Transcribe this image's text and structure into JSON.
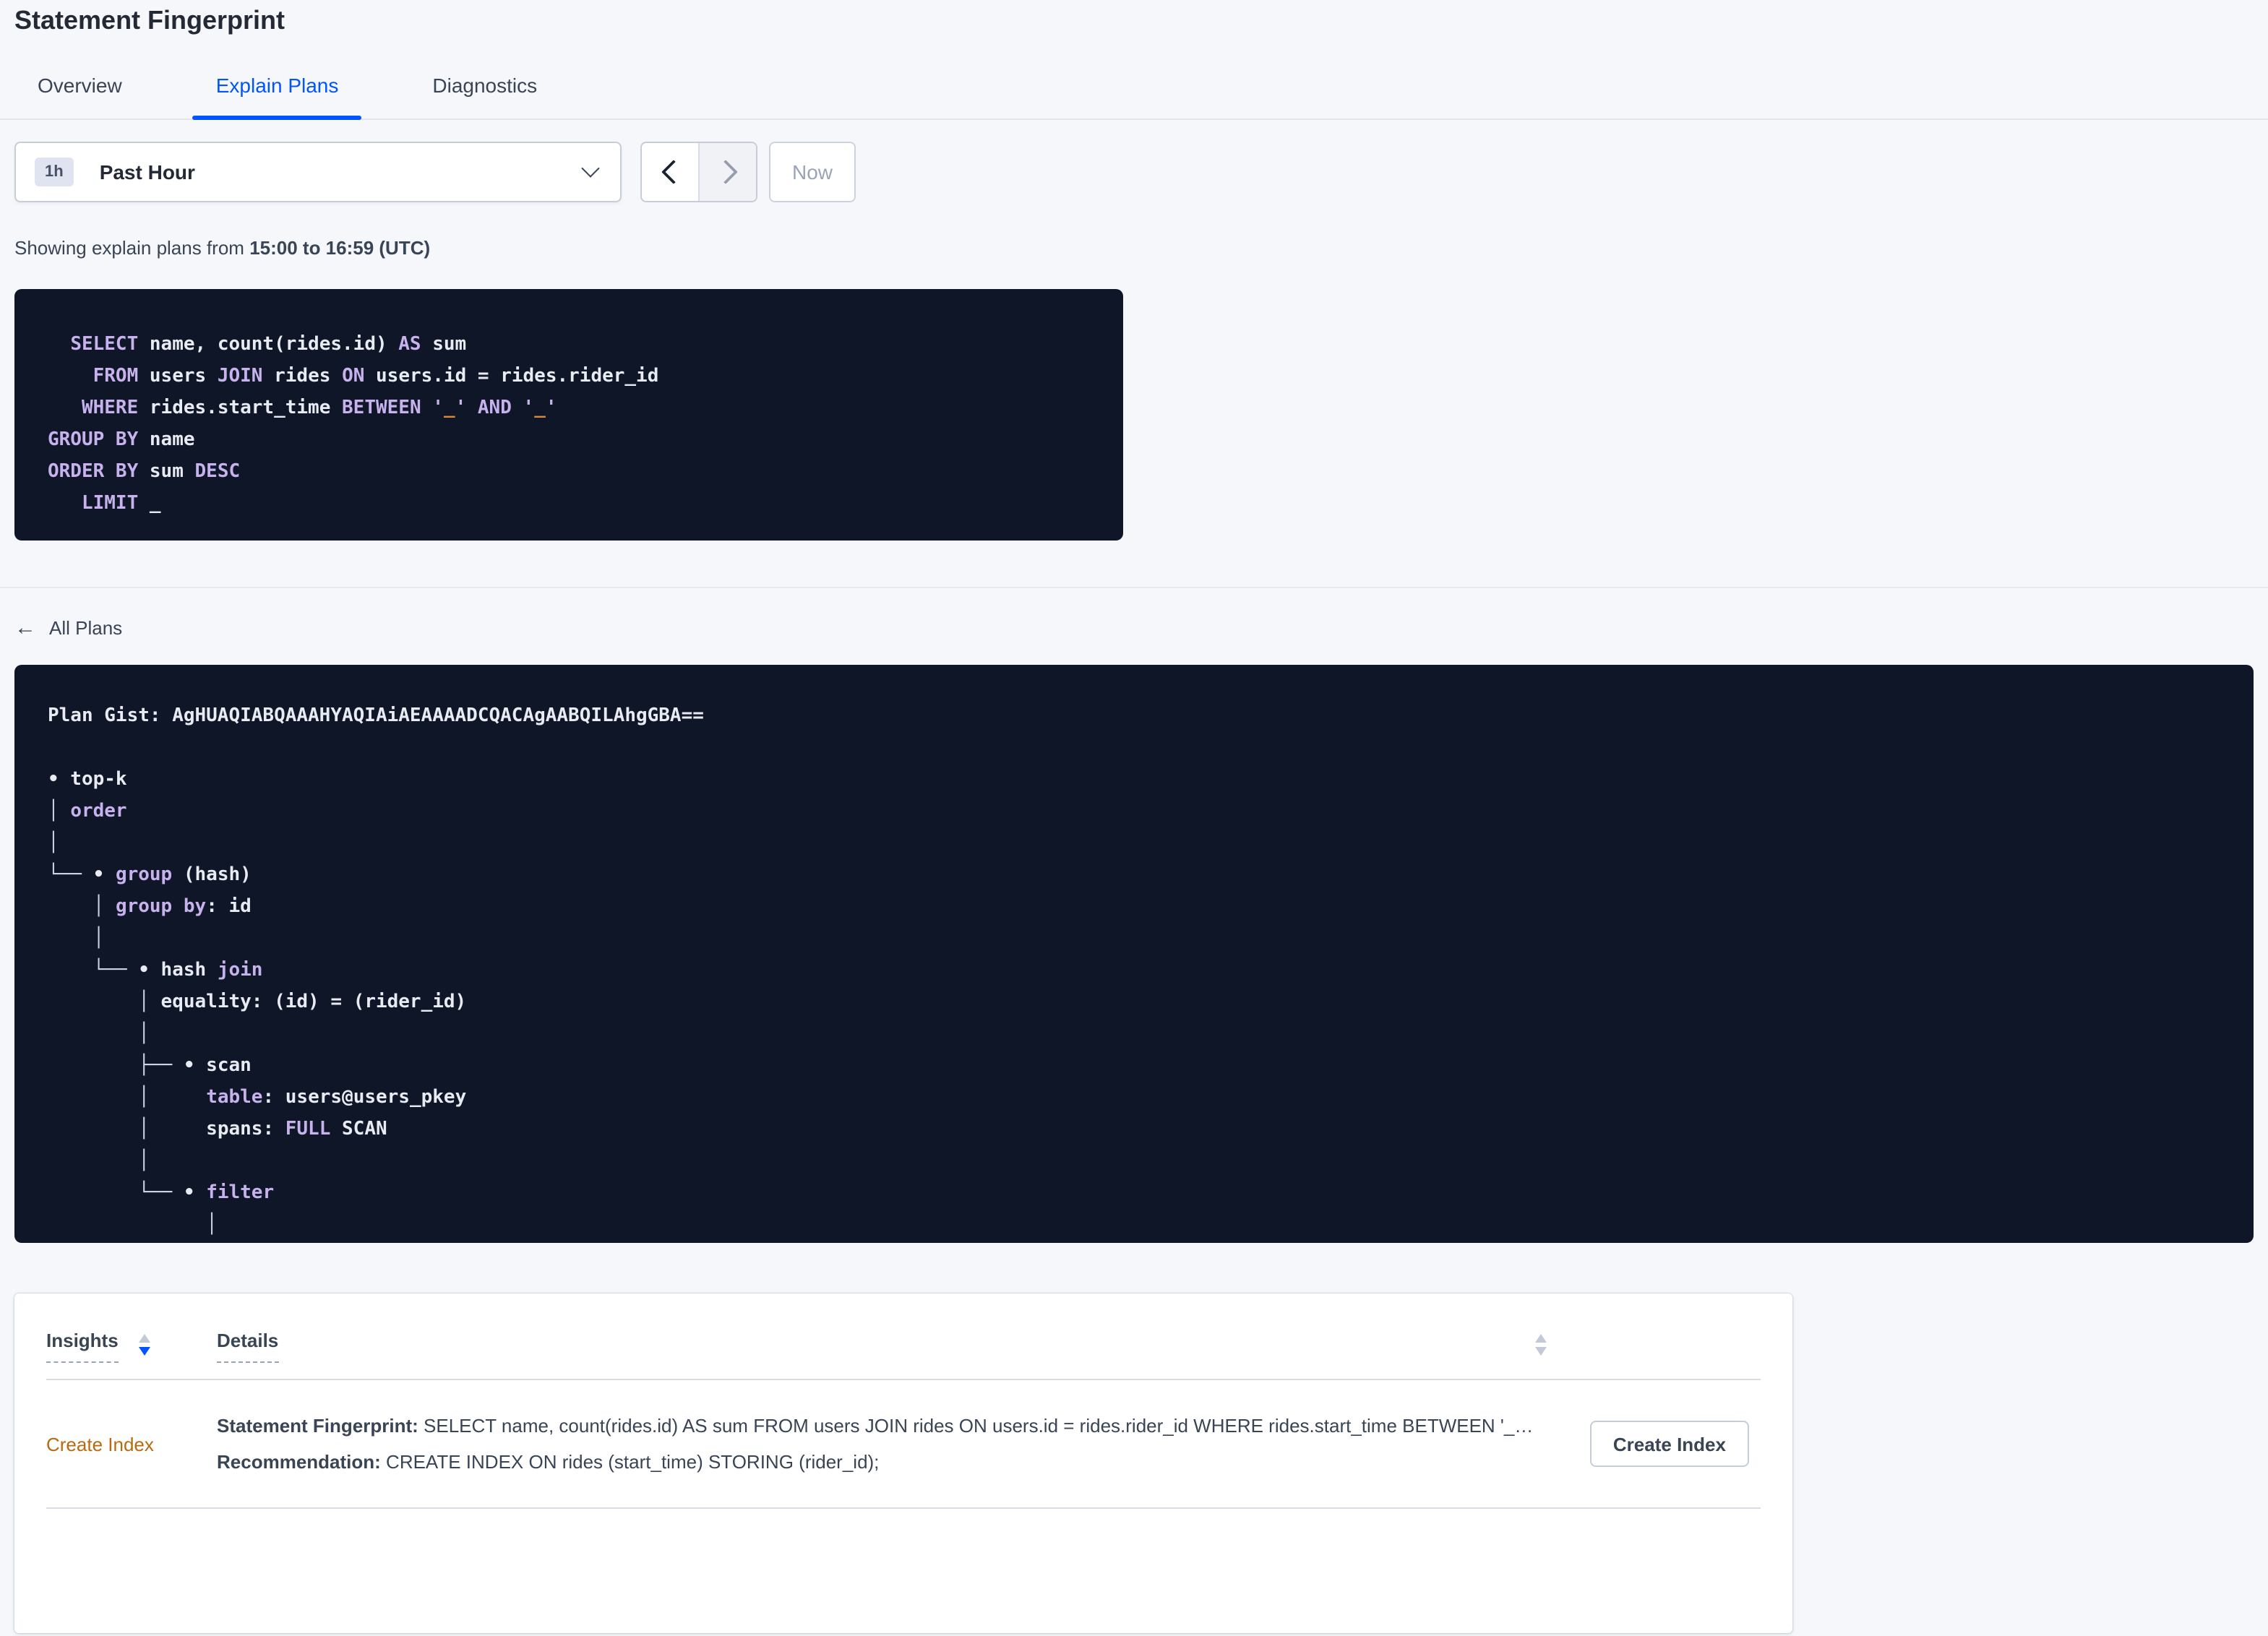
{
  "page": {
    "title": "Statement Fingerprint",
    "all_plans_label": "All Plans",
    "showing_prefix": "Showing explain plans from ",
    "showing_range": "15:00 to 16:59 (UTC)"
  },
  "tabs": [
    {
      "label": "Overview"
    },
    {
      "label": "Explain Plans"
    },
    {
      "label": "Diagnostics"
    }
  ],
  "active_tab": "Explain Plans",
  "time_picker": {
    "badge": "1h",
    "label": "Past Hour",
    "now_label": "Now"
  },
  "sql_preview": {
    "lines": [
      {
        "seg": [
          {
            "t": "  "
          },
          {
            "t": "SELECT",
            "c": "kw"
          },
          {
            "t": " name, count(rides.id) "
          },
          {
            "t": "AS",
            "c": "kw"
          },
          {
            "t": " sum"
          }
        ]
      },
      {
        "seg": [
          {
            "t": "    "
          },
          {
            "t": "FROM",
            "c": "kw"
          },
          {
            "t": " users "
          },
          {
            "t": "JOIN",
            "c": "kw"
          },
          {
            "t": " rides "
          },
          {
            "t": "ON",
            "c": "kw"
          },
          {
            "t": " users.id = rides.rider_id"
          }
        ]
      },
      {
        "seg": [
          {
            "t": "   "
          },
          {
            "t": "WHERE",
            "c": "kw"
          },
          {
            "t": " rides.start_time "
          },
          {
            "t": "BETWEEN",
            "c": "kw"
          },
          {
            "t": " "
          },
          {
            "t": "'",
            "c": "kw"
          },
          {
            "t": "_",
            "c": "ph"
          },
          {
            "t": "'",
            "c": "kw"
          },
          {
            "t": " "
          },
          {
            "t": "AND",
            "c": "kw"
          },
          {
            "t": " "
          },
          {
            "t": "'",
            "c": "kw"
          },
          {
            "t": "_",
            "c": "ph"
          },
          {
            "t": "'",
            "c": "kw"
          }
        ]
      },
      {
        "seg": [
          {
            "t": "GROUP BY",
            "c": "kw"
          },
          {
            "t": " name"
          }
        ]
      },
      {
        "seg": [
          {
            "t": "ORDER BY",
            "c": "kw"
          },
          {
            "t": " sum "
          },
          {
            "t": "DESC",
            "c": "kw"
          }
        ]
      },
      {
        "seg": [
          {
            "t": "   "
          },
          {
            "t": "LIMIT",
            "c": "kw"
          },
          {
            "t": " _"
          }
        ]
      }
    ]
  },
  "plan": {
    "gist_label": "Plan Gist: ",
    "gist": "AgHUAQIABQAAAHYAQIAiAEAAAADCQACAgAABQILAhgGBA==",
    "tree": [
      {
        "seg": [
          {
            "t": "• top-k"
          }
        ]
      },
      {
        "seg": [
          {
            "t": "│",
            "c": "tr"
          },
          {
            "t": " "
          },
          {
            "t": "order",
            "c": "kw"
          }
        ]
      },
      {
        "seg": [
          {
            "t": "│",
            "c": "tr"
          }
        ]
      },
      {
        "seg": [
          {
            "t": "└── ",
            "c": "tr"
          },
          {
            "t": "• "
          },
          {
            "t": "group",
            "c": "kw"
          },
          {
            "t": " (hash)"
          }
        ]
      },
      {
        "seg": [
          {
            "t": "    "
          },
          {
            "t": "│",
            "c": "tr"
          },
          {
            "t": " "
          },
          {
            "t": "group by",
            "c": "kw"
          },
          {
            "t": ": id"
          }
        ]
      },
      {
        "seg": [
          {
            "t": "    "
          },
          {
            "t": "│",
            "c": "tr"
          }
        ]
      },
      {
        "seg": [
          {
            "t": "    "
          },
          {
            "t": "└── ",
            "c": "tr"
          },
          {
            "t": "• hash "
          },
          {
            "t": "join",
            "c": "kw"
          }
        ]
      },
      {
        "seg": [
          {
            "t": "        "
          },
          {
            "t": "│",
            "c": "tr"
          },
          {
            "t": " equality: (id) = (rider_id)"
          }
        ]
      },
      {
        "seg": [
          {
            "t": "        "
          },
          {
            "t": "│",
            "c": "tr"
          }
        ]
      },
      {
        "seg": [
          {
            "t": "        "
          },
          {
            "t": "├── ",
            "c": "tr"
          },
          {
            "t": "• scan"
          }
        ]
      },
      {
        "seg": [
          {
            "t": "        "
          },
          {
            "t": "│",
            "c": "tr"
          },
          {
            "t": "     "
          },
          {
            "t": "table",
            "c": "kw"
          },
          {
            "t": ": users@users_pkey"
          }
        ]
      },
      {
        "seg": [
          {
            "t": "        "
          },
          {
            "t": "│",
            "c": "tr"
          },
          {
            "t": "     spans: "
          },
          {
            "t": "FULL",
            "c": "kw"
          },
          {
            "t": " SCAN"
          }
        ]
      },
      {
        "seg": [
          {
            "t": "        "
          },
          {
            "t": "│",
            "c": "tr"
          }
        ]
      },
      {
        "seg": [
          {
            "t": "        "
          },
          {
            "t": "└── ",
            "c": "tr"
          },
          {
            "t": "• "
          },
          {
            "t": "filter",
            "c": "kw"
          }
        ]
      },
      {
        "seg": [
          {
            "t": "              "
          },
          {
            "t": "│",
            "c": "tr"
          }
        ]
      }
    ]
  },
  "insights": {
    "columns": [
      {
        "label": "Insights"
      },
      {
        "label": "Details"
      }
    ],
    "rows": [
      {
        "insight": "Create Index",
        "fingerprint_label": "Statement Fingerprint:",
        "fingerprint": " SELECT name, count(rides.id) AS sum FROM users JOIN rides ON users.id = rides.rider_id WHERE rides.start_time BETWEEN '_…",
        "recommendation_label": "Recommendation:",
        "recommendation": " CREATE INDEX ON rides (start_time) STORING (rider_id);",
        "action_label": "Create Index"
      }
    ]
  },
  "colors": {
    "accent_blue": "#0055ff",
    "code_bg": "#0e1627",
    "code_text": "#e8ebf2",
    "keyword_purple": "#c7b2ee",
    "placeholder_orange": "#d9893b",
    "insight_orange": "#b96a11"
  }
}
